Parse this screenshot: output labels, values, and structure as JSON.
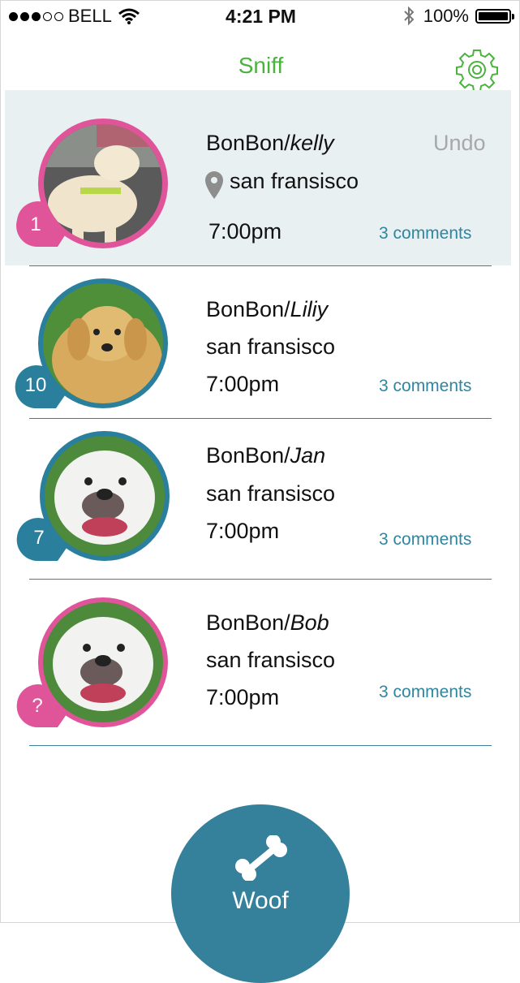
{
  "status_bar": {
    "carrier": "BELL",
    "time": "4:21 PM",
    "battery": "100%"
  },
  "nav": {
    "title": "Sniff",
    "settings_icon": "gear-icon"
  },
  "feed": [
    {
      "badge": "1",
      "name": "BonBon/",
      "owner": "kelly",
      "location": "san fransisco",
      "time": "7:00pm",
      "comments": "3 comments",
      "undo": "Undo",
      "ring_color": "#e0559a",
      "dog": "labrador"
    },
    {
      "badge": "10",
      "name": "BonBon/",
      "owner": "Liliy",
      "location": "san fransisco",
      "time": "7:00pm",
      "comments": "3 comments",
      "ring_color": "#2a7f9c",
      "dog": "golden-retriever"
    },
    {
      "badge": "7",
      "name": "BonBon/",
      "owner": "Jan",
      "location": "san fransisco",
      "time": "7:00pm",
      "comments": "3 comments",
      "ring_color": "#2a7f9c",
      "dog": "bulldog"
    },
    {
      "badge": "?",
      "name": "BonBon/",
      "owner": "Bob",
      "location": "san fransisco",
      "time": "7:00pm",
      "comments": "3 comments",
      "ring_color": "#e0559a",
      "dog": "bulldog"
    }
  ],
  "woof_button": {
    "label": "Woof",
    "icon": "bone-icon"
  },
  "colors": {
    "accent_green": "#4ab33e",
    "teal": "#35809a",
    "pink": "#e0559a",
    "link": "#2f86a0"
  }
}
